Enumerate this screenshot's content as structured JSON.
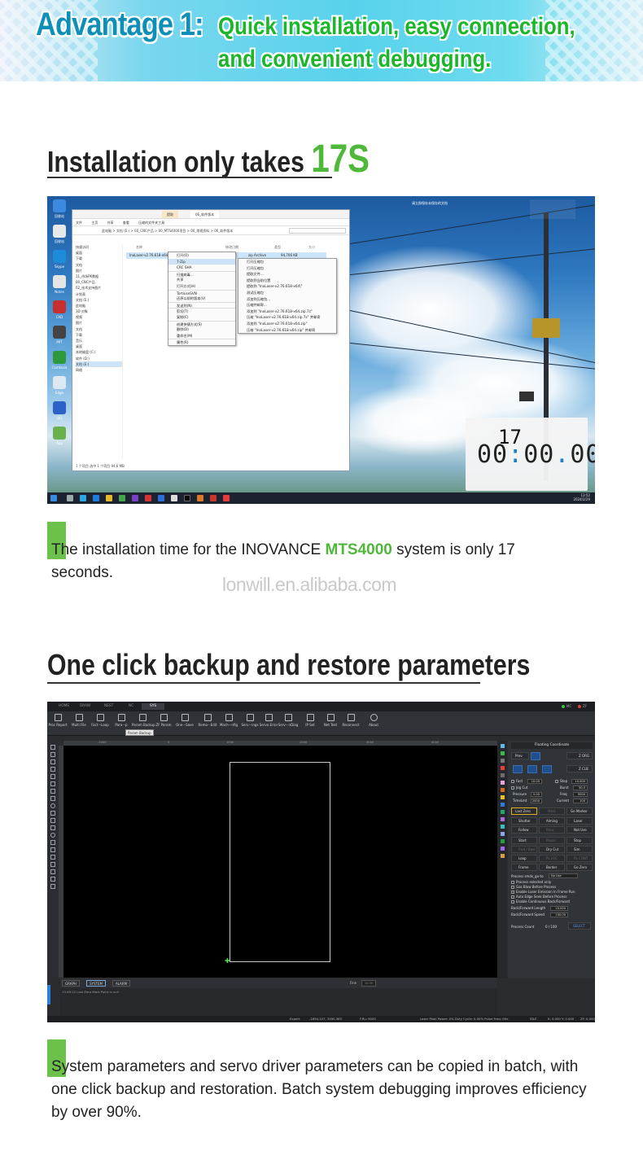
{
  "banner": {
    "title": "Advantage 1:",
    "subtitle_line1": "Quick installation, easy connection,",
    "subtitle_line2": "and convenient debugging."
  },
  "section1": {
    "heading_prefix": "Installation only takes ",
    "heading_highlight": "17S",
    "desktop": {
      "explorer": {
        "tabs": [
          "提取",
          "06_软件版本"
        ],
        "ribbon": [
          "文件",
          "主页",
          "共享",
          "查看",
          "压缩的文件夹工具"
        ],
        "address": "此电脑 > 文档 (E:) > 00_CNC产品 > 00_MTS4000项目 > 00_常规资料 > 06_软件版本",
        "columns": [
          "名称",
          "修改日期",
          "类型",
          "大小"
        ],
        "file_row": {
          "name": "InoLaser-v2.76.618-x64.zip",
          "date": "2023/12/28 16:02",
          "type": "zip Archive",
          "size": "94,706 KB"
        },
        "nav": [
          "快速访问",
          "桌面",
          "下载",
          "文档",
          "图片",
          "11_市场PK数据",
          "00_CNC产品",
          "02_技术支持图片",
          "计划表",
          "文档 (E:)",
          "此电脑",
          "3D 对象",
          "视频",
          "图片",
          "文档",
          "下载",
          "音乐",
          "桌面",
          "本地磁盘 (C:)",
          "软件 (D:)",
          "文档 (E:)",
          "网络"
        ],
        "status": "1 个项目    选中 1 个项目 94.6 MB"
      },
      "context_menu": [
        "打开(O)",
        "7-Zip",
        "CRC SHA",
        "扫描病毒...",
        "共享",
        "打开方式(H)",
        "TortoiseSVN",
        "还原以前的版本(V)",
        "发送到(N)",
        "剪切(T)",
        "复制(C)",
        "创建快捷方式(S)",
        "删除(D)",
        "重命名(M)",
        "属性(R)"
      ],
      "submenu": [
        "打开压缩包",
        "打开压缩包",
        "提取文件...",
        "提取到当前位置",
        "提取到 \"InoLaser-v2.76.618-x64\\\"",
        "测试压缩包",
        "添加到压缩包...",
        "压缩并邮寄...",
        "添加到 \"InoLaser-v2.76.618-x64.zip.7z\"",
        "压缩 \"InoLaser-v2.76.618-x64.zip.7z\" 并邮寄",
        "添加到 \"InoLaser-v2.76.618-x64.zip\"",
        "压缩 \"InoLaser-v2.76.618-x64.zip\" 并邮寄"
      ],
      "notification": "请立即保存未保存的文档",
      "timer_seconds": "17",
      "timer_main_a": "00",
      "timer_main_b": "00",
      "timer_main_c": "00",
      "clock_time": "13:52",
      "clock_date": "2024/2/29"
    },
    "caption_part1": "The installation time for the INOVANCE ",
    "caption_highlight": "MTS4000",
    "caption_part2": " system is only 17 seconds.",
    "watermark": "lonwill.en.alibaba.com"
  },
  "section2": {
    "heading": "One click backup and restore parameters",
    "software": {
      "tabs": [
        "HOME",
        "DRAW",
        "NEST",
        "NC",
        "SYS"
      ],
      "status_right": [
        "MC",
        "ZF"
      ],
      "toolbar": [
        "Proc Report",
        "Multi File",
        "Fact···Loop",
        "Para···p",
        "Param Backup",
        "ZF Param",
        "One···Save",
        "Remo···Edit",
        "Mach···nfig",
        "Serv···ings",
        "Servo Error",
        "Serv···nDiag",
        "IP Set",
        "Net Test",
        "Reconnect",
        "About"
      ],
      "tooltip": "Param Backup",
      "ruler_ticks": [
        "-1000",
        "0",
        "1000",
        "2000",
        "3000",
        "4000"
      ],
      "bottom_tabs": [
        "GRAPH",
        "SYSTEM",
        "ALARM"
      ],
      "fine_label": "Fine",
      "fine_value": "10.00",
      "log_line": "13:49:12  Last Zero Mark Point is null",
      "status_bar": {
        "user": "Expert",
        "coords": "-1694.107, 3490.385",
        "fru": "F.Ru: 9000",
        "laser": "Laser Peak Power: 0%  Duty Cycle: 0.00%  Pulse Freq: 0Hz",
        "state": "IDLE",
        "kxy": "K: 0.000 Y: 0.000",
        "zf": "ZF: 0.000"
      },
      "right_panel": {
        "title": "Floating Coordinate",
        "prev": "Prev",
        "zorg": "Z ORG",
        "zclb": "Z CLB",
        "fast_label": "Fast",
        "fast_val": "10.00",
        "step_label": "Step",
        "step_val": "10.000",
        "jog_label": "Jog Cut",
        "burst_label": "Burst",
        "burst_val": "50.0",
        "pressure_label": "Pressure",
        "pressure_val": "5.00",
        "freq_label": "Freq",
        "freq_val": "5000",
        "timelimit_label": "TimeLmt",
        "timelimit_val": "2000",
        "current_label": "Current",
        "current_val": "100",
        "lastzero": "Last Zero",
        "mark": "Mark",
        "gomarker": "Go Marker",
        "buttons": [
          "Shutter",
          "Aiming",
          "Laser",
          "Follow",
          "Blow",
          "Not Use",
          "Start",
          "Pause",
          "Stop",
          "Fwd / Bwd",
          "Dry Cut",
          "Sim",
          "Loop",
          "PL LOC",
          "PL CONT",
          "Frame",
          "Border",
          "Go Zero"
        ],
        "process_label": "Process smds_go-to",
        "process_val": "No Use",
        "options": [
          "Process selected only",
          "Gas Blow Before Process",
          "Enable Laser Emission In Frame Run",
          "Auto Edge Seek Before Process",
          "Enable Continuous Back/Forward"
        ],
        "bf_length_label": "Back/Forward Length",
        "bf_length_val": "10.000",
        "bf_speed_label": "Back/Forward Speed",
        "bf_speed_val": "100.00",
        "count_label": "Process Count",
        "count_val": "0 / 100",
        "count_btn": "SELECT"
      }
    },
    "caption": "System parameters and servo driver parameters can be copied in batch, with one click backup and restoration. Batch system debugging improves efficiency by over 90%."
  }
}
